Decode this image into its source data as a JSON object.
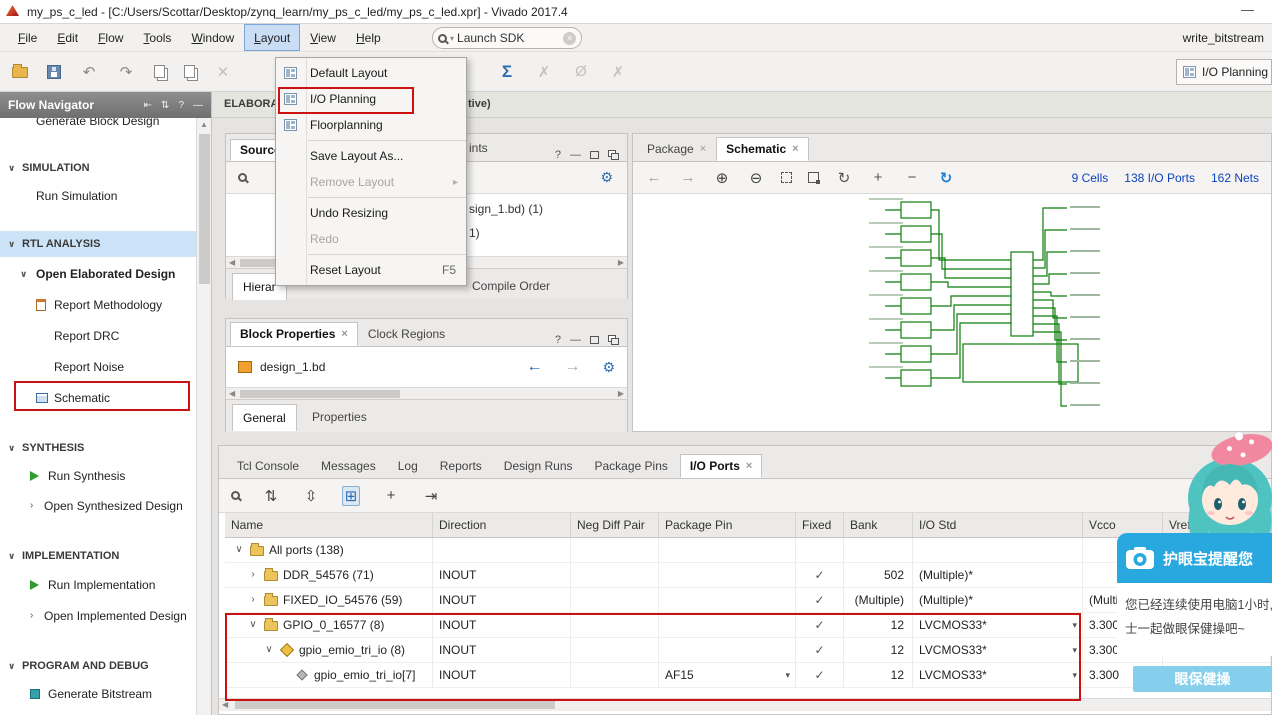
{
  "colors": {
    "accent_blue": "#2f6db3",
    "link_blue": "#0c43bd",
    "highlight_red": "#cc1111",
    "selection_blue": "#cde4f8",
    "wire_green": "#0b7d0b",
    "popup_blue": "#29a8e0"
  },
  "titlebar": {
    "title": "my_ps_c_led - [C:/Users/Scottar/Desktop/zynq_learn/my_ps_c_led/my_ps_c_led.xpr] - Vivado 2017.4"
  },
  "menubar": {
    "items": [
      "File",
      "Edit",
      "Flow",
      "Tools",
      "Window",
      "Layout",
      "View",
      "Help"
    ],
    "active": "Layout",
    "search_value": "Launch SDK",
    "right_text": "write_bitstream"
  },
  "toolbar": {
    "layout_selector": "I/O Planning"
  },
  "layout_menu": {
    "default_layout": "Default Layout",
    "io_planning": "I/O Planning",
    "floorplanning": "Floorplanning",
    "save_layout_as": "Save Layout As...",
    "remove_layout": "Remove Layout",
    "undo_resizing": "Undo Resizing",
    "redo": "Redo",
    "reset_layout": "Reset Layout",
    "reset_shortcut": "F5"
  },
  "flow_navigator": {
    "title": "Flow Navigator",
    "clipped_item": "Generate Block Design",
    "simulation_header": "SIMULATION",
    "run_simulation": "Run Simulation",
    "rtl_header": "RTL ANALYSIS",
    "open_elaborated": "Open Elaborated Design",
    "report_methodology": "Report Methodology",
    "report_drc": "Report DRC",
    "report_noise": "Report Noise",
    "schematic": "Schematic",
    "synthesis_header": "SYNTHESIS",
    "run_synthesis": "Run Synthesis",
    "open_synthesized": "Open Synthesized Design",
    "implementation_header": "IMPLEMENTATION",
    "run_implementation": "Run Implementation",
    "open_implemented": "Open Implemented Design",
    "program_header": "PROGRAM AND DEBUG",
    "generate_bitstream": "Generate Bitstream"
  },
  "context_banner": {
    "left_fragment": "ELABORA",
    "right_fragment": "tive)"
  },
  "sources_panel": {
    "title": "Sources",
    "header_fragment": "ints",
    "tree_fragment_1": "sign_1.bd) (1)",
    "tree_fragment_2": "1)",
    "tab_fragment": "Hierar",
    "tab_compile_order": "Compile Order"
  },
  "block_properties": {
    "tab_block_properties": "Block Properties",
    "tab_clock_regions": "Clock Regions",
    "object_name": "design_1.bd",
    "tab_general": "General",
    "tab_properties": "Properties"
  },
  "schematic_panel": {
    "tab_package": "Package",
    "tab_schematic": "Schematic",
    "cells_link": "9 Cells",
    "ports_link": "138 I/O Ports",
    "nets_link": "162 Nets"
  },
  "bottom_panel": {
    "tabs": [
      "Tcl Console",
      "Messages",
      "Log",
      "Reports",
      "Design Runs",
      "Package Pins",
      "I/O Ports"
    ],
    "active_tab": "I/O Ports",
    "columns": [
      "Name",
      "Direction",
      "Neg Diff Pair",
      "Package Pin",
      "Fixed",
      "Bank",
      "I/O Std",
      "Vcco",
      "Vref"
    ],
    "rows": [
      {
        "name": "All ports (138)",
        "direction": "",
        "neg_diff_pair": "",
        "package_pin": "",
        "fixed": "",
        "bank": "",
        "io_std": "",
        "vcco": "",
        "vref": ""
      },
      {
        "name": "DDR_54576 (71)",
        "direction": "INOUT",
        "neg_diff_pair": "",
        "package_pin": "",
        "fixed": "✓",
        "bank": "502",
        "io_std": "(Multiple)*",
        "vcco": "",
        "vref": ""
      },
      {
        "name": "FIXED_IO_54576 (59)",
        "direction": "INOUT",
        "neg_diff_pair": "",
        "package_pin": "",
        "fixed": "✓",
        "bank": "(Multiple)",
        "io_std": "(Multiple)*",
        "vcco": "(Multiple)",
        "vref": ""
      },
      {
        "name": "GPIO_0_16577 (8)",
        "direction": "INOUT",
        "neg_diff_pair": "",
        "package_pin": "",
        "fixed": "✓",
        "bank": "12",
        "io_std": "LVCMOS33*",
        "vcco": "3.300",
        "vref": ""
      },
      {
        "name": "gpio_emio_tri_io (8)",
        "direction": "INOUT",
        "neg_diff_pair": "",
        "package_pin": "",
        "fixed": "✓",
        "bank": "12",
        "io_std": "LVCMOS33*",
        "vcco": "3.300",
        "vref": ""
      },
      {
        "name": "gpio_emio_tri_io[7]",
        "direction": "INOUT",
        "neg_diff_pair": "",
        "package_pin": "AF15",
        "fixed": "✓",
        "bank": "12",
        "io_std": "LVCMOS33*",
        "vcco": "3.300",
        "vref": ""
      }
    ]
  },
  "overlay": {
    "popup_title": "护眼宝提醒您",
    "body_line1": "您已经连续使用电脑1小时,",
    "body_line2": "士一起做眼保健操吧~",
    "button": "眼保健操"
  },
  "icons": {
    "expand_open": "∨",
    "expand_closed": "›",
    "check": "✓",
    "close": "×",
    "minimize": "—",
    "help": "?",
    "back_arrow": "←",
    "forward_arrow": "→",
    "undo": "↶",
    "redo": "↷",
    "sigma": "Σ",
    "delete_x": "✕",
    "disabled_x": "✗",
    "disabled_o": "Ø",
    "refresh": "↻",
    "gear": "⚙",
    "zoom_in": "⊕",
    "zoom_out": "⊖",
    "plus": "+",
    "minus": "−",
    "submenu_arrow": "▸",
    "dropdown_caret": "▾",
    "left_scroll": "◀",
    "right_scroll": "▶",
    "up_scroll": "▲",
    "collapse_all": "⇅",
    "expand_all": "⇳",
    "group": "⊞",
    "route": "⇥",
    "nav_collapse": "⇤"
  }
}
